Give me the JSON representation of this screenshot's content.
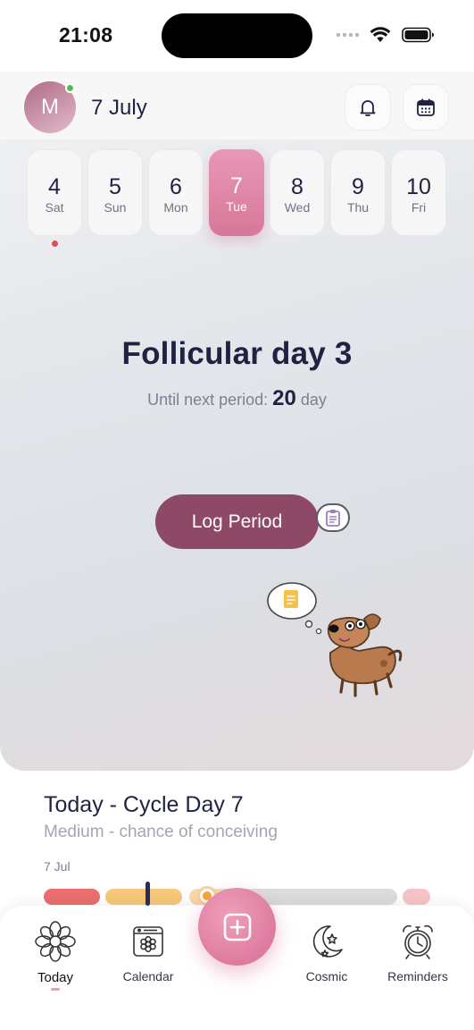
{
  "status_bar": {
    "time": "21:08"
  },
  "header": {
    "avatar_initial": "M",
    "date": "7 July"
  },
  "week": [
    {
      "num": "4",
      "weekday": "Sat"
    },
    {
      "num": "5",
      "weekday": "Sun"
    },
    {
      "num": "6",
      "weekday": "Mon"
    },
    {
      "num": "7",
      "weekday": "Tue"
    },
    {
      "num": "8",
      "weekday": "Wed"
    },
    {
      "num": "9",
      "weekday": "Thu"
    },
    {
      "num": "10",
      "weekday": "Fri"
    }
  ],
  "selected_day": "7",
  "phase": {
    "title": "Follicular day 3",
    "next_period_label": "Until next period:",
    "next_period_value": "20",
    "next_period_unit": "day"
  },
  "log_period_label": "Log Period",
  "cycle": {
    "title": "Today - Cycle Day 7",
    "subtitle": "Medium - chance of conceiving",
    "date_label": "7 Jul"
  },
  "nav": [
    {
      "id": "today",
      "label": "Today",
      "icon": "flower-icon"
    },
    {
      "id": "calendar",
      "label": "Calendar",
      "icon": "calendar-flower-icon"
    },
    {
      "id": "cosmic",
      "label": "Cosmic",
      "icon": "moon-stars-icon"
    },
    {
      "id": "reminders",
      "label": "Reminders",
      "icon": "alarm-clock-icon"
    }
  ],
  "colors": {
    "accent_pink": "#de7b9f",
    "log_button": "#8e4966",
    "period": "#ec6e6e",
    "fertile": "#f7c77a",
    "online_dot": "#4cbb5b"
  }
}
